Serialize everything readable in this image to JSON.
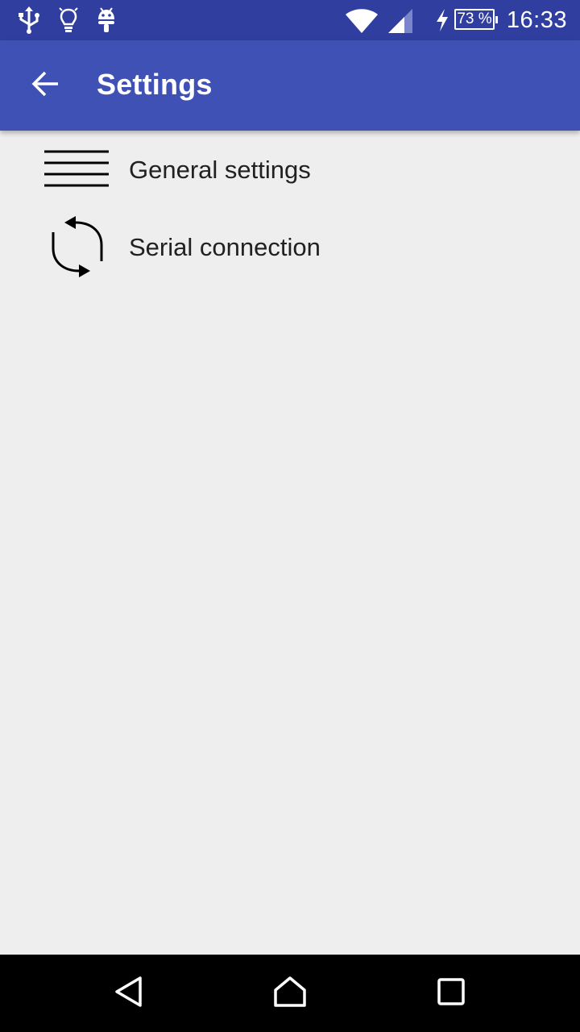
{
  "status_bar": {
    "time": "16:33",
    "battery": "73 %",
    "icons": [
      "usb-icon",
      "lightbulb-icon",
      "android-icon",
      "wifi-icon",
      "cell-signal-icon",
      "charging-icon",
      "battery-icon"
    ]
  },
  "app_bar": {
    "title": "Settings",
    "back_icon": "arrow-back-icon"
  },
  "settings_list": {
    "items": [
      {
        "label": "General settings",
        "icon": "menu-lines-icon"
      },
      {
        "label": "Serial connection",
        "icon": "sync-icon"
      }
    ]
  },
  "nav_bar": {
    "buttons": [
      "back-triangle-icon",
      "home-icon",
      "recents-icon"
    ]
  },
  "colors": {
    "status_bar": "#303f9f",
    "app_bar": "#3f51b5",
    "background": "#eeeeee",
    "nav_bar": "#000000"
  }
}
